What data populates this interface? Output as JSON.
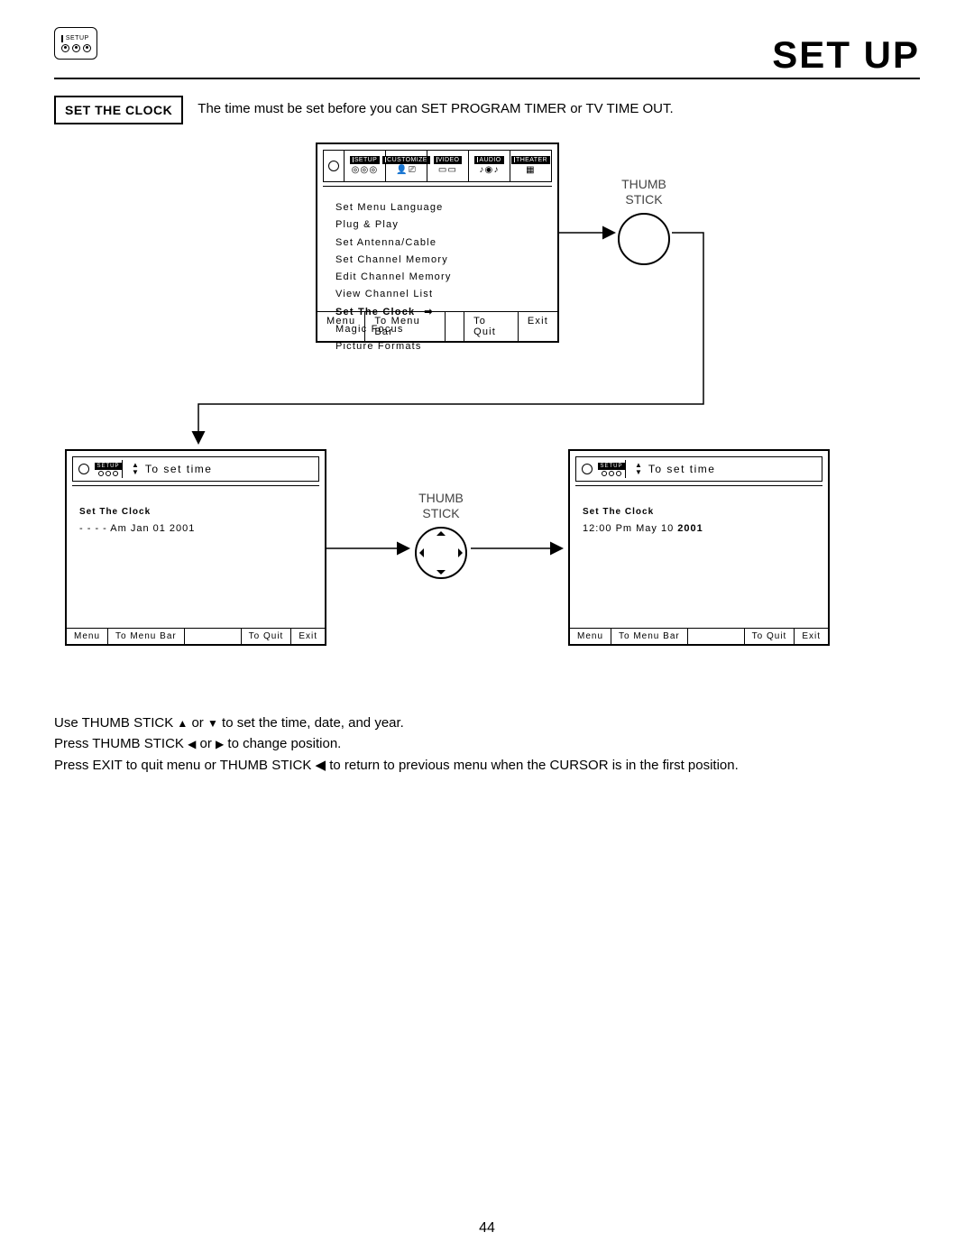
{
  "page": {
    "title": "SET UP",
    "page_number": "44"
  },
  "setup_chip": {
    "label": "SETUP"
  },
  "intro": {
    "box_label": "SET THE CLOCK",
    "text": "The time must be set before you can  SET PROGRAM TIMER or TV TIME OUT."
  },
  "main_osd": {
    "tabs": [
      "SETUP",
      "CUSTOMIZE",
      "VIDEO",
      "AUDIO",
      "THEATER"
    ],
    "items": [
      "Set Menu Language",
      "Plug & Play",
      "Set Antenna/Cable",
      "Set Channel Memory",
      "Edit Channel Memory",
      "View Channel List",
      "Set The Clock",
      "Magic Focus",
      "Picture Formats"
    ],
    "selected_index": 6,
    "footer": {
      "a": "Menu",
      "b": "To Menu Bar",
      "c": "To Quit",
      "d": "Exit"
    }
  },
  "thumb_label": "THUMB\nSTICK",
  "clock_left": {
    "hdr_chip": "SETUP",
    "hdr_text": "To set time",
    "title": "Set The Clock",
    "value": "- -  - - Am Jan 01 2001",
    "footer": {
      "a": "Menu",
      "b": "To Menu Bar",
      "c": "To Quit",
      "d": "Exit"
    }
  },
  "clock_right": {
    "hdr_chip": "SETUP",
    "hdr_text": "To set time",
    "title": "Set The Clock",
    "value_prefix": "12:00 Pm May 10 ",
    "value_bold": "2001",
    "footer": {
      "a": "Menu",
      "b": "To Menu Bar",
      "c": "To Quit",
      "d": "Exit"
    }
  },
  "instructions": {
    "l1a": "Use THUMB STICK ",
    "l1b": " or ",
    "l1c": " to set the time, date, and year.",
    "l2a": "Press THUMB STICK ",
    "l2b": " or ",
    "l2c": " to change position.",
    "l3": "Press EXIT to quit menu or THUMB STICK ◀ to return to previous menu when the CURSOR is in the first position."
  }
}
